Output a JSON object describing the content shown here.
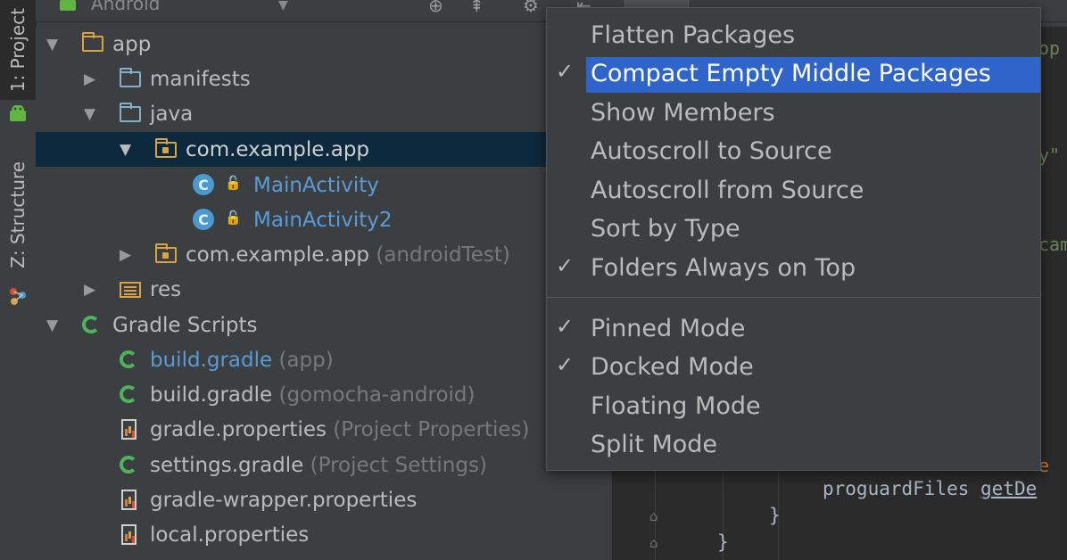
{
  "sidebar": {
    "tabs": [
      {
        "label": "1: Project"
      },
      {
        "label": "Z: Structure"
      }
    ]
  },
  "header": {
    "view_selector": "Android"
  },
  "tree": {
    "items": [
      {
        "label": "app",
        "hint": ""
      },
      {
        "label": "manifests",
        "hint": ""
      },
      {
        "label": "java",
        "hint": ""
      },
      {
        "label": "com.example.app",
        "hint": ""
      },
      {
        "label": "MainActivity",
        "hint": ""
      },
      {
        "label": "MainActivity2",
        "hint": ""
      },
      {
        "label": "com.example.app",
        "hint": "(androidTest)"
      },
      {
        "label": "res",
        "hint": ""
      },
      {
        "label": "Gradle Scripts",
        "hint": ""
      },
      {
        "label": "build.gradle",
        "hint": "(app)"
      },
      {
        "label": "build.gradle",
        "hint": "(gomocha-android)"
      },
      {
        "label": "gradle.properties",
        "hint": "(Project Properties)"
      },
      {
        "label": "settings.gradle",
        "hint": "(Project Settings)"
      },
      {
        "label": "gradle-wrapper.properties",
        "hint": ""
      },
      {
        "label": "local.properties",
        "hint": ""
      }
    ]
  },
  "menu": {
    "items": [
      {
        "label": "Flatten Packages",
        "checked": false
      },
      {
        "label": "Compact Empty Middle Packages",
        "checked": true,
        "highlighted": true
      },
      {
        "label": "Show Members",
        "checked": false
      },
      {
        "label": "Autoscroll to Source",
        "checked": false
      },
      {
        "label": "Autoscroll from Source",
        "checked": false
      },
      {
        "label": "Sort by Type",
        "checked": false
      },
      {
        "label": "Folders Always on Top",
        "checked": true
      },
      {
        "label": "Pinned Mode",
        "checked": true
      },
      {
        "label": "Docked Mode",
        "checked": true
      },
      {
        "label": "Floating Mode",
        "checked": false
      },
      {
        "label": "Split Mode",
        "checked": false
      }
    ],
    "check_glyph": "✓"
  },
  "editor": {
    "line1": "proguardFiles ",
    "line1_call": "getDe",
    "line2": "}",
    "line3": "}"
  },
  "colors": {
    "selection": "#0d293e",
    "menu_highlight": "#2f65ca",
    "class_icon": "#4a9ad0",
    "gradle_icon": "#4fb35b",
    "folder_icon": "#87aec7",
    "package_icon": "#d9a343"
  }
}
